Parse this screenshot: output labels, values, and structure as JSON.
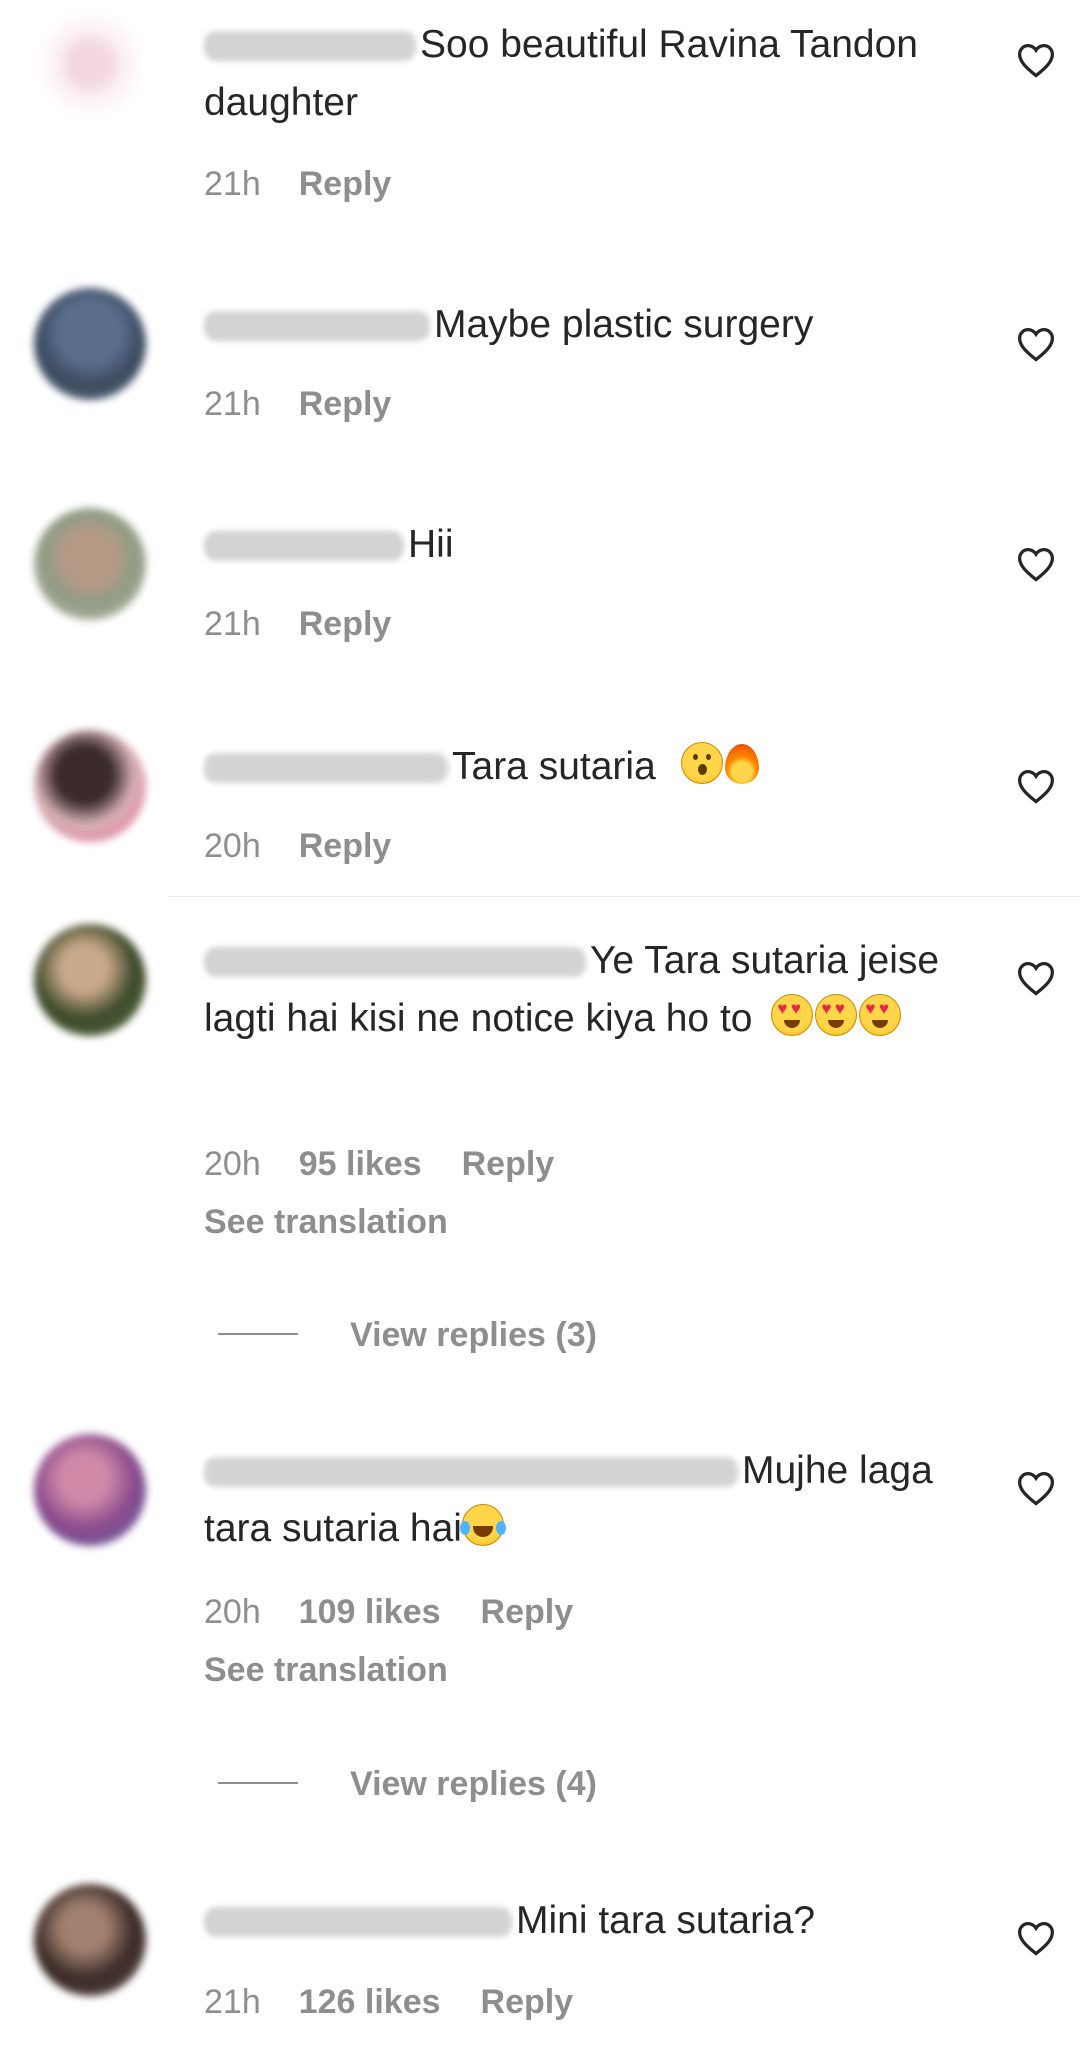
{
  "comments": [
    {
      "text": "Soo beautiful Ravina Tandon daughter",
      "time": "21h",
      "reply_label": "Reply"
    },
    {
      "text": "Maybe plastic surgery",
      "time": "21h",
      "reply_label": "Reply"
    },
    {
      "text": "Hii",
      "time": "21h",
      "reply_label": "Reply"
    },
    {
      "text": "Tara sutaria",
      "time": "20h",
      "reply_label": "Reply"
    },
    {
      "text": "Ye Tara sutaria jeise lagti hai kisi ne notice kiya ho to",
      "time": "20h",
      "likes": "95 likes",
      "reply_label": "Reply",
      "see_translation": "See translation",
      "view_replies": "View replies (3)"
    },
    {
      "text": "Mujhe laga tara sutaria hai",
      "time": "20h",
      "likes": "109 likes",
      "reply_label": "Reply",
      "see_translation": "See translation",
      "view_replies": "View replies (4)"
    },
    {
      "text": "Mini tara sutaria?",
      "time": "21h",
      "likes": "126 likes",
      "reply_label": "Reply"
    }
  ],
  "icons": {
    "like": "heart-outline-icon"
  },
  "colors": {
    "text": "#262626",
    "secondary_text": "#8e8e8e",
    "background": "#ffffff"
  }
}
